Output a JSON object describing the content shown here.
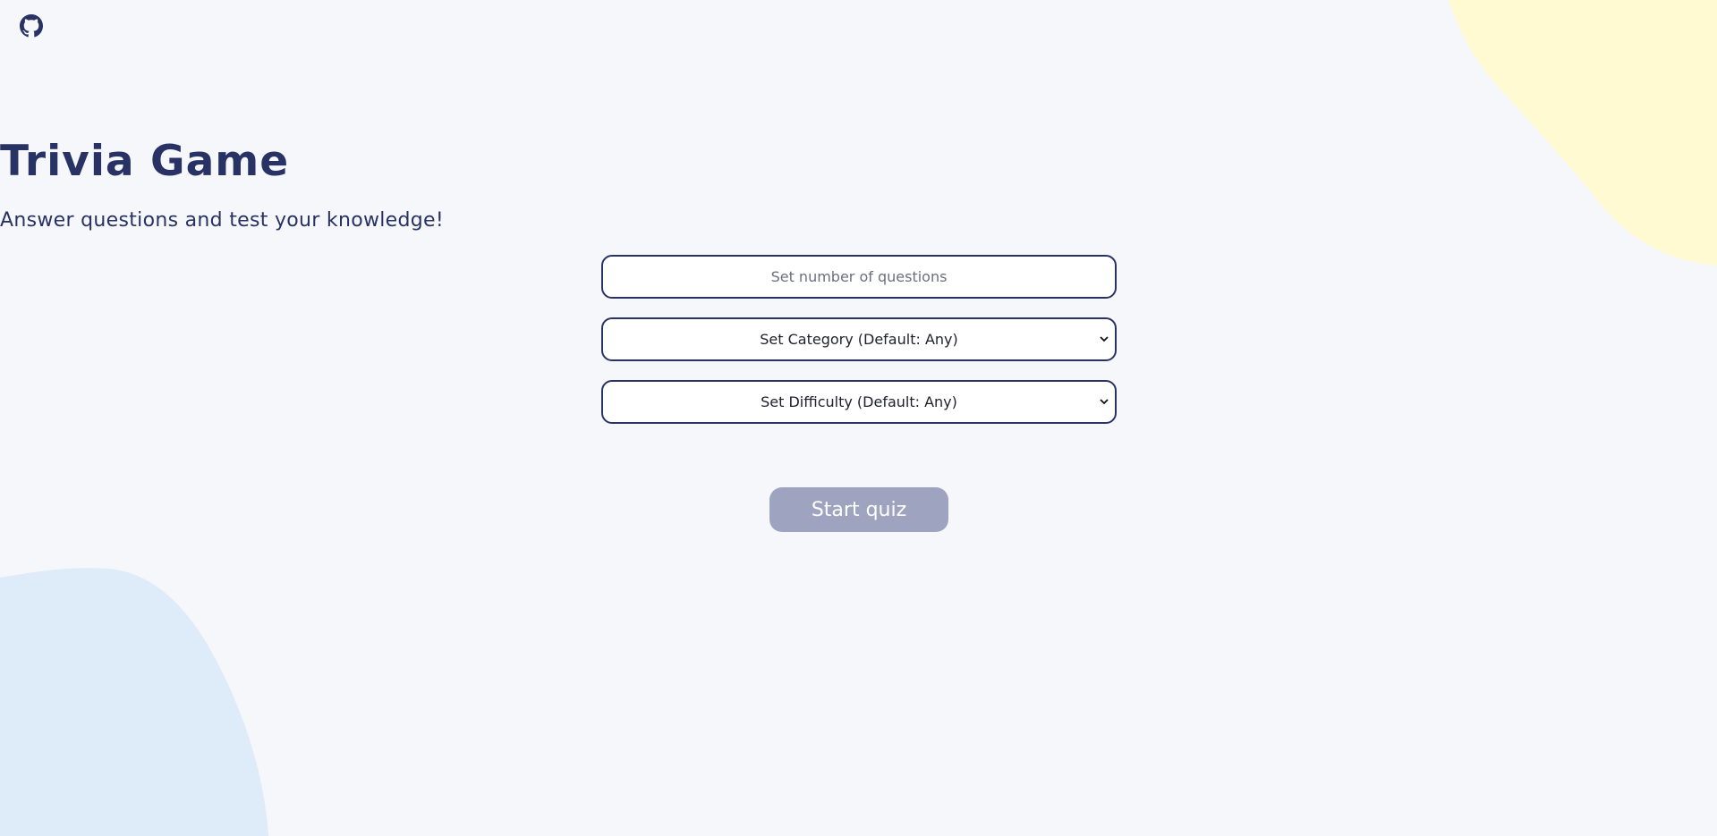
{
  "header": {
    "github_icon": "github-icon"
  },
  "main": {
    "title": "Trivia Game",
    "subtitle": "Answer questions and test your knowledge!",
    "questions_input": {
      "value": "",
      "placeholder": "Set number of questions"
    },
    "category_select": {
      "selected": "Set Category (Default: Any)"
    },
    "difficulty_select": {
      "selected": "Set Difficulty (Default: Any)"
    },
    "start_button_label": "Start quiz"
  },
  "colors": {
    "background": "#f5f7fb",
    "primary": "#293264",
    "button_disabled": "#9ea3bf",
    "blob_yellow": "#fffaD1",
    "blob_blue": "#deebf8"
  },
  "icons": {
    "select_caret": "chevron-down-icon"
  }
}
